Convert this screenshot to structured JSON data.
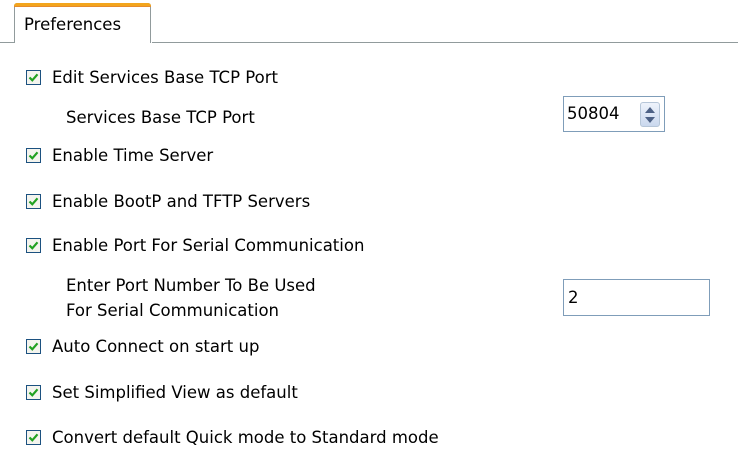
{
  "tab": {
    "label": "Preferences"
  },
  "options": [
    {
      "label": "Edit Services Base TCP Port",
      "checked": true
    },
    {
      "label": "Enable Time Server",
      "checked": true
    },
    {
      "label": "Enable BootP and TFTP Servers",
      "checked": true
    },
    {
      "label": "Enable Port For Serial Communication",
      "checked": true
    },
    {
      "label": "Auto Connect on start up",
      "checked": true
    },
    {
      "label": "Set Simplified View as default",
      "checked": true
    },
    {
      "label": "Convert default Quick mode to Standard mode",
      "checked": true
    }
  ],
  "base_port": {
    "label": "Services Base TCP Port",
    "value": "50804"
  },
  "serial_port": {
    "label_line1": "Enter Port Number To Be Used",
    "label_line2": "For Serial Communication",
    "value": "2"
  },
  "colors": {
    "tab_accent": "#f3a51d",
    "checkbox_mark": "#21a121",
    "border": "#7f9db9"
  }
}
